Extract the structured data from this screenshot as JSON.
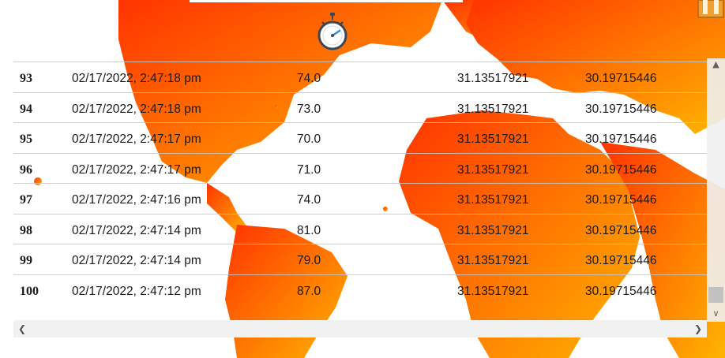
{
  "icons": {
    "stopwatch": "stopwatch-icon",
    "scroll_left": "chevron-left-icon",
    "scroll_right": "chevron-right-icon",
    "scroll_up": "chevron-up-icon",
    "scroll_down": "chevron-down-icon"
  },
  "colors": {
    "map_start": "#ff3d00",
    "map_end": "#ffb000",
    "text": "#1a1a1a",
    "row_divider": "#c8c8c8"
  },
  "table": {
    "rows": [
      {
        "id": "93",
        "datetime": "02/17/2022, 2:47:18 pm",
        "value": "74.0",
        "lat": "31.13517921",
        "lon": "30.19715446"
      },
      {
        "id": "94",
        "datetime": "02/17/2022, 2:47:18 pm",
        "value": "73.0",
        "lat": "31.13517921",
        "lon": "30.19715446"
      },
      {
        "id": "95",
        "datetime": "02/17/2022, 2:47:17 pm",
        "value": "70.0",
        "lat": "31.13517921",
        "lon": "30.19715446"
      },
      {
        "id": "96",
        "datetime": "02/17/2022, 2:47:17 pm",
        "value": "71.0",
        "lat": "31.13517921",
        "lon": "30.19715446"
      },
      {
        "id": "97",
        "datetime": "02/17/2022, 2:47:16 pm",
        "value": "74.0",
        "lat": "31.13517921",
        "lon": "30.19715446"
      },
      {
        "id": "98",
        "datetime": "02/17/2022, 2:47:14 pm",
        "value": "81.0",
        "lat": "31.13517921",
        "lon": "30.19715446"
      },
      {
        "id": "99",
        "datetime": "02/17/2022, 2:47:14 pm",
        "value": "79.0",
        "lat": "31.13517921",
        "lon": "30.19715446"
      },
      {
        "id": "100",
        "datetime": "02/17/2022, 2:47:12 pm",
        "value": "87.0",
        "lat": "31.13517921",
        "lon": "30.19715446"
      }
    ]
  }
}
